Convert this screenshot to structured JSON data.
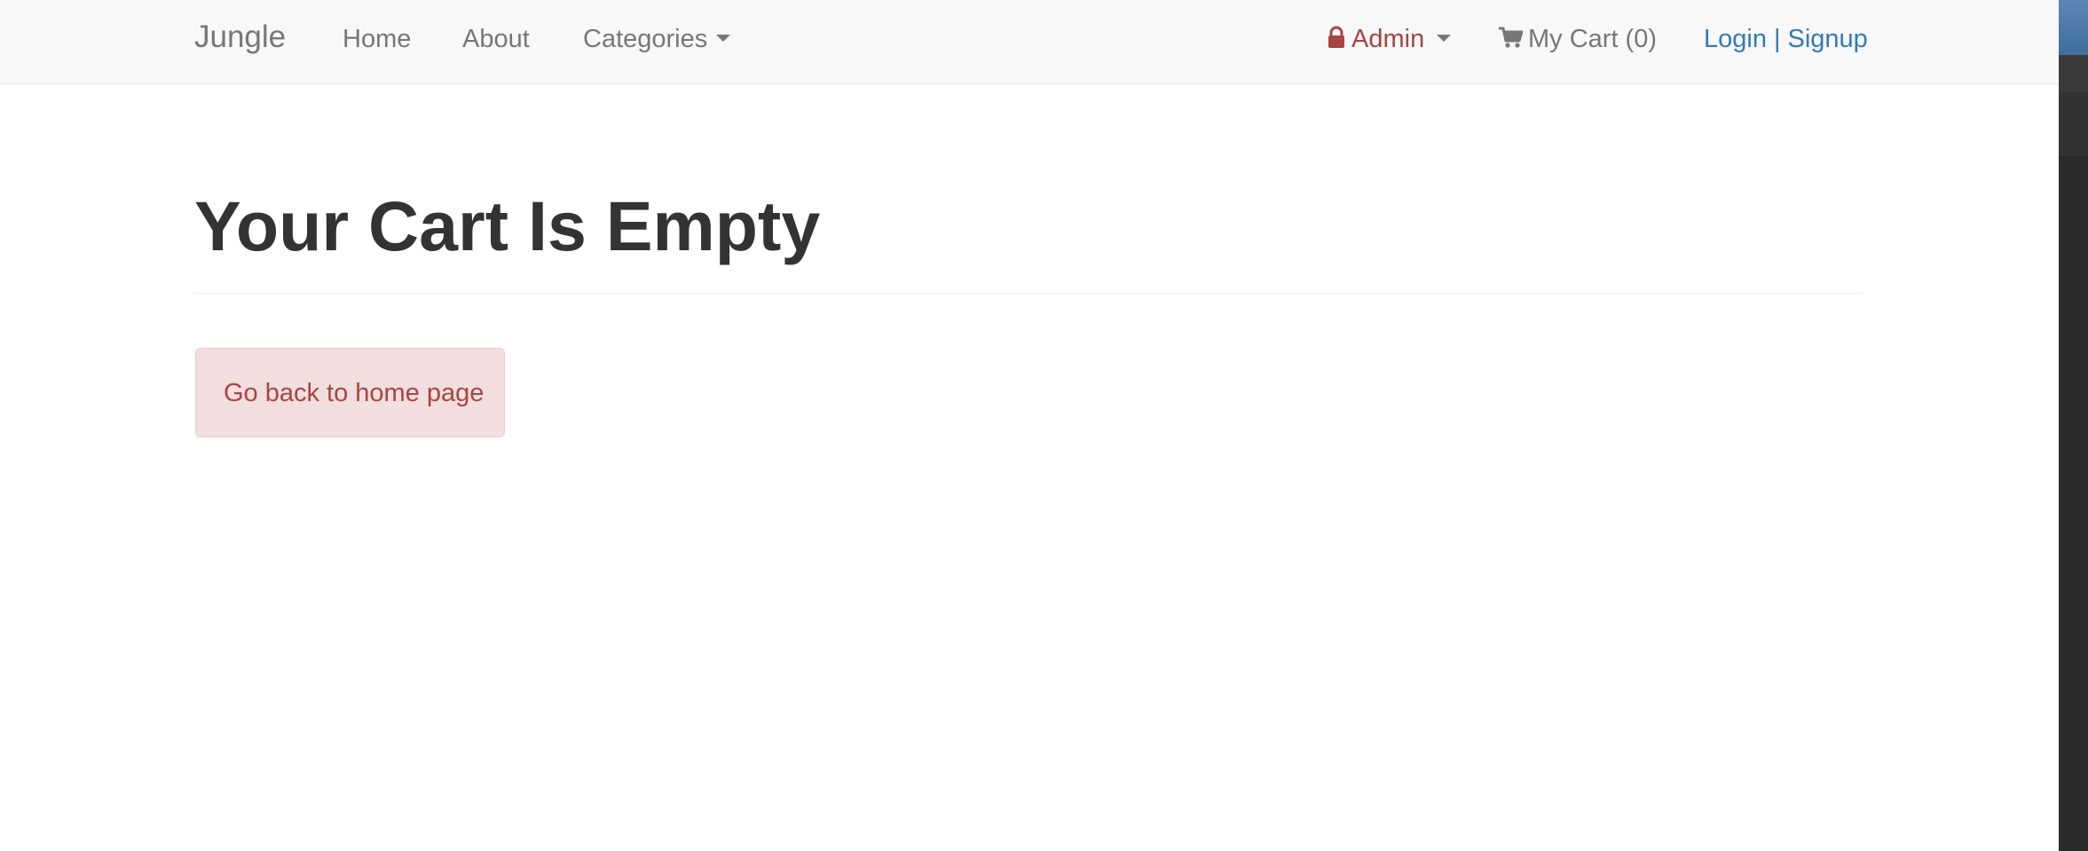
{
  "navbar": {
    "brand": "Jungle",
    "home": "Home",
    "about": "About",
    "categories": "Categories",
    "admin": "Admin",
    "cart": "My Cart (0)",
    "login": "Login",
    "separator": "|",
    "signup": "Signup"
  },
  "main": {
    "title": "Your Cart Is Empty",
    "back_link": "Go back to home page"
  },
  "colors": {
    "navbar_bg": "#f8f8f8",
    "nav_text": "#777777",
    "admin_text": "#a94442",
    "link_blue": "#337ab7",
    "alert_bg": "#f2dede",
    "alert_border": "#ebccd1",
    "alert_text": "#a94442",
    "title_text": "#333333"
  },
  "icons": {
    "admin": "lock-icon",
    "cart": "shopping-cart-icon",
    "dropdown": "caret-down-icon"
  }
}
